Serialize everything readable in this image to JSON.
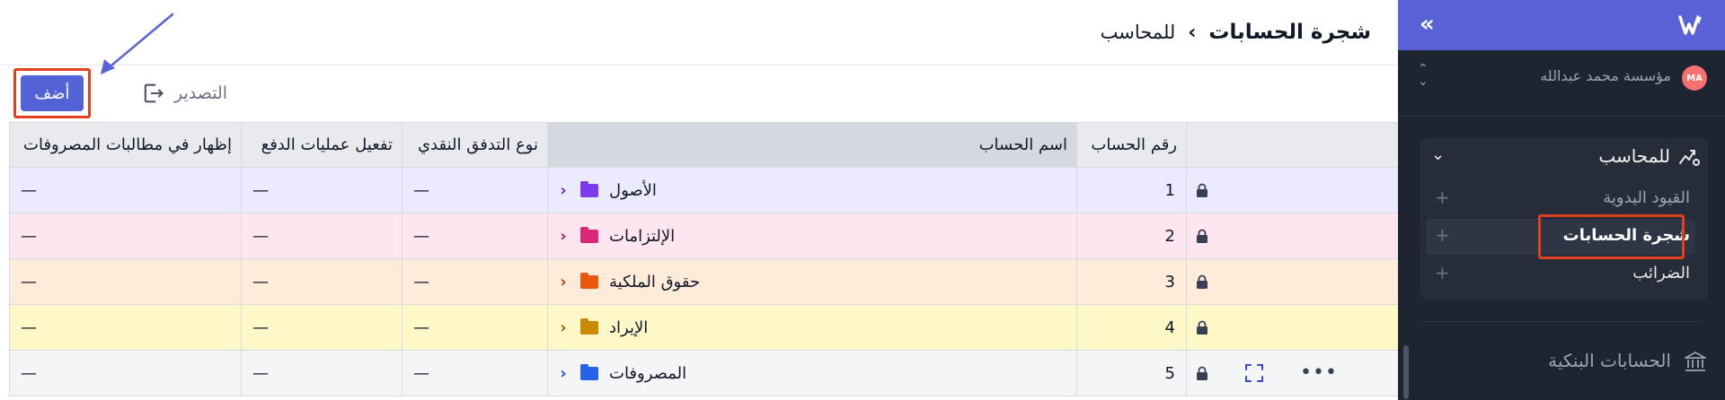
{
  "header": {
    "breadcrumb_parent": "للمحاسب",
    "breadcrumb_separator": "›",
    "breadcrumb_current": "شجرة الحسابات"
  },
  "toolbar": {
    "add_label": "أضف",
    "export_label": "التصدير"
  },
  "table": {
    "columns": {
      "account_number": "رقم الحساب",
      "account_name": "اسم الحساب",
      "cash_flow_type": "نوع التدفق النقدي",
      "enable_payments": "تفعيل عمليات الدفع",
      "show_in_expense_claims": "إظهار في مطالبات المصروفات"
    },
    "rows": [
      {
        "number": "1",
        "name": "الأصول",
        "cash_flow": "—",
        "payments": "—",
        "expense_claims": "—",
        "folder_color": "#7c3aed",
        "chevron_color": "#6d28d9"
      },
      {
        "number": "2",
        "name": "الإلتزامات",
        "cash_flow": "—",
        "payments": "—",
        "expense_claims": "—",
        "folder_color": "#db2777",
        "chevron_color": "#be185d"
      },
      {
        "number": "3",
        "name": "حقوق الملكية",
        "cash_flow": "—",
        "payments": "—",
        "expense_claims": "—",
        "folder_color": "#ea580c",
        "chevron_color": "#c2410c"
      },
      {
        "number": "4",
        "name": "الإيراد",
        "cash_flow": "—",
        "payments": "—",
        "expense_claims": "—",
        "folder_color": "#ca8a04",
        "chevron_color": "#a16207"
      },
      {
        "number": "5",
        "name": "المصروفات",
        "cash_flow": "—",
        "payments": "—",
        "expense_claims": "—",
        "folder_color": "#2563eb",
        "chevron_color": "#1d4ed8"
      }
    ]
  },
  "sidebar": {
    "logo_icon": "w-logo-icon",
    "collapse_glyph": "«",
    "org": {
      "avatar_initials": "MA",
      "name": "مؤسسة محمد عبدالله"
    },
    "accounting": {
      "title": "للمحاسب",
      "items": [
        {
          "label": "القيود اليدوية",
          "plus": "+"
        },
        {
          "label": "شجرة الحسابات",
          "plus": "+"
        },
        {
          "label": "الضرائب",
          "plus": "+"
        }
      ]
    },
    "bank_accounts_label": "الحسابات البنكية"
  },
  "colors": {
    "accent": "#5861d6",
    "add_button": "#5362d6",
    "highlight": "#e0401f",
    "sidebar_bg": "#1f2530"
  }
}
